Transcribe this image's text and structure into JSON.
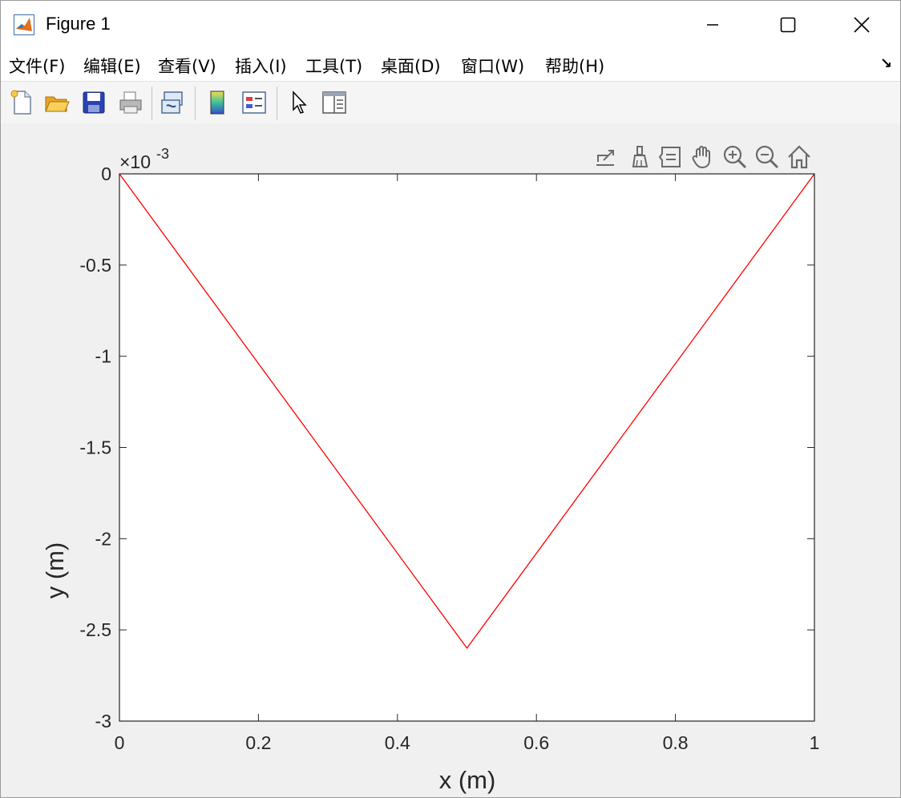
{
  "window": {
    "title": "Figure 1"
  },
  "menu": {
    "items": [
      "文件(F)",
      "编辑(E)",
      "查看(V)",
      "插入(I)",
      "工具(T)",
      "桌面(D)",
      "窗口(W)",
      "帮助(H)"
    ]
  },
  "toolbar": {
    "icons": [
      "new-figure-icon",
      "open-file-icon",
      "save-icon",
      "print-icon",
      "link-plot-icon",
      "colorbar-icon",
      "legend-icon",
      "pointer-icon",
      "property-inspector-icon"
    ]
  },
  "axes_toolbar": {
    "icons": [
      "export-icon",
      "brush-icon",
      "data-tips-icon",
      "pan-icon",
      "zoom-in-icon",
      "zoom-out-icon",
      "home-icon"
    ]
  },
  "chart_data": {
    "type": "line",
    "xlabel": "x (m)",
    "ylabel": "y (m)",
    "exponent_label": "×10",
    "exponent_power": "-3",
    "xlim": [
      0,
      1
    ],
    "ylim": [
      -3,
      0
    ],
    "y_scale_factor": 0.001,
    "x_ticks": [
      0,
      0.2,
      0.4,
      0.6,
      0.8,
      1
    ],
    "x_tick_labels": [
      "0",
      "0.2",
      "0.4",
      "0.6",
      "0.8",
      "1"
    ],
    "y_ticks": [
      0,
      -0.5,
      -1,
      -1.5,
      -2,
      -2.5,
      -3
    ],
    "y_tick_labels": [
      "0",
      "-0.5",
      "-1",
      "-1.5",
      "-2",
      "-2.5",
      "-3"
    ],
    "grid": false,
    "series": [
      {
        "color": "#ff0000",
        "x": [
          0,
          0.5,
          1
        ],
        "y": [
          0,
          -2.6,
          0
        ]
      }
    ]
  }
}
